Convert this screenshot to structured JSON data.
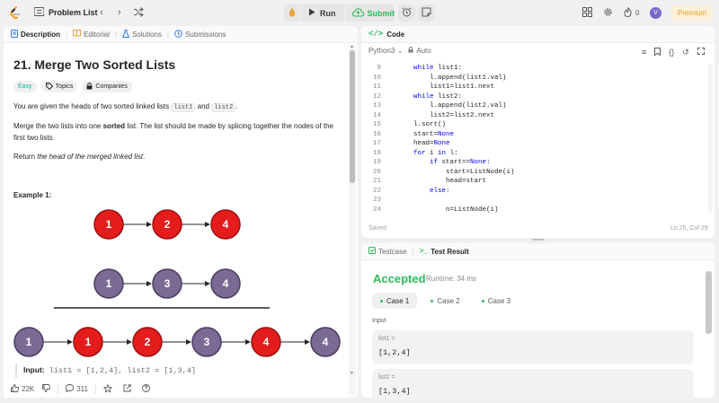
{
  "topbar": {
    "problem_list": "Problem List",
    "run": "Run",
    "submit": "Submit",
    "fire_count": "0",
    "avatar_letter": "V",
    "premium": "Premium"
  },
  "left_tabs": [
    {
      "label": "Description",
      "icon": "description-icon"
    },
    {
      "label": "Editorial",
      "icon": "book-icon"
    },
    {
      "label": "Solutions",
      "icon": "flask-icon"
    },
    {
      "label": "Submissions",
      "icon": "history-icon"
    }
  ],
  "problem": {
    "title": "21. Merge Two Sorted Lists",
    "difficulty": "Easy",
    "topics": "Topics",
    "companies": "Companies",
    "p1_pre": "You are given the heads of two sorted linked lists ",
    "p1_code1": "list1",
    "p1_mid": " and ",
    "p1_code2": "list2",
    "p1_post": ".",
    "p2_pre": "Merge the two lists into one ",
    "p2_bold": "sorted",
    "p2_post": " list. The list should be made by splicing together the nodes of the first two lists.",
    "p3_pre": "Return ",
    "p3_em": "the head of the merged linked list",
    "p3_post": ".",
    "example_title": "Example 1:",
    "example_input_label": "Input:",
    "example_input_value": "list1 = [1,2,4], list2 = [1,3,4]"
  },
  "diagram": {
    "list1": [
      "1",
      "2",
      "4"
    ],
    "list2": [
      "1",
      "3",
      "4"
    ],
    "merged": [
      "1",
      "1",
      "2",
      "3",
      "4",
      "4"
    ],
    "merged_colors": [
      "purple",
      "red",
      "red",
      "purple",
      "red",
      "purple"
    ],
    "colors": {
      "red": "#e51c1c",
      "purple": "#7b6a94",
      "red_border": "#9c1010",
      "purple_border": "#4a3d5f"
    }
  },
  "footer": {
    "likes": "22K",
    "comments": "311"
  },
  "code_panel": {
    "title": "Code",
    "language": "Python3",
    "auto": "Auto",
    "saved": "Saved",
    "cursor": "Ln 25, Col 29",
    "lines": [
      {
        "n": "9",
        "text": "    while list1:"
      },
      {
        "n": "10",
        "text": "        l.append(list1.val)"
      },
      {
        "n": "11",
        "text": "        list1=list1.next"
      },
      {
        "n": "12",
        "text": "    while list2:"
      },
      {
        "n": "13",
        "text": "        l.append(list2.val)"
      },
      {
        "n": "14",
        "text": "        list2=list2.next"
      },
      {
        "n": "15",
        "text": "    l.sort()"
      },
      {
        "n": "16",
        "text": "    start=None"
      },
      {
        "n": "17",
        "text": "    head=None"
      },
      {
        "n": "18",
        "text": "    for i in l:"
      },
      {
        "n": "19",
        "text": "        if start==None:"
      },
      {
        "n": "20",
        "text": "            start=ListNode(i)"
      },
      {
        "n": "21",
        "text": "            head=start"
      },
      {
        "n": "22",
        "text": "        else:"
      },
      {
        "n": "23",
        "text": ""
      },
      {
        "n": "24",
        "text": "            n=ListNode(i)"
      }
    ]
  },
  "result_panel": {
    "tab_testcase": "Testcase",
    "tab_result": "Test Result",
    "status": "Accepted",
    "runtime": "Runtime: 34 ms",
    "cases": [
      "Case 1",
      "Case 2",
      "Case 3"
    ],
    "input_label": "Input",
    "vars": [
      {
        "name": "list1 =",
        "value": "[1,2,4]"
      },
      {
        "name": "list2 =",
        "value": "[1,3,4]"
      }
    ]
  }
}
